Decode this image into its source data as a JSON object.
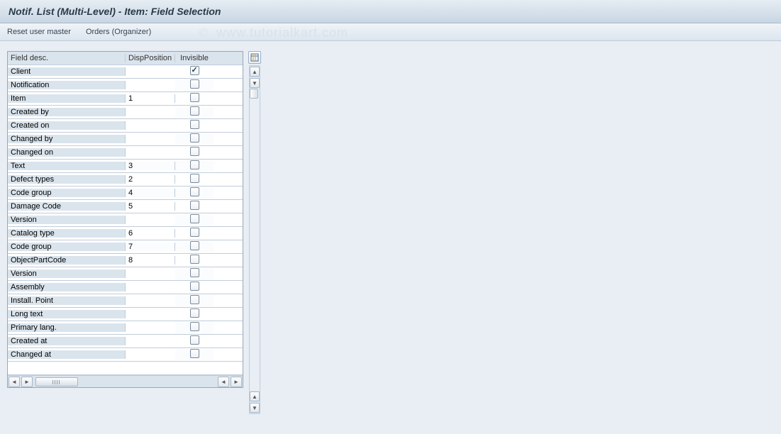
{
  "header": {
    "title": "Notif. List (Multi-Level) - Item: Field Selection"
  },
  "toolbar": {
    "reset_label": "Reset user master",
    "orders_label": "Orders (Organizer)"
  },
  "watermark": {
    "copy": "©",
    "text": "www.tutorialkart.com"
  },
  "grid": {
    "columns": {
      "desc": "Field desc.",
      "pos": "DispPosition",
      "inv": "Invisible"
    },
    "rows": [
      {
        "desc": "Client",
        "pos": "",
        "inv": true
      },
      {
        "desc": "Notification",
        "pos": "",
        "inv": false
      },
      {
        "desc": "Item",
        "pos": "1",
        "inv": false
      },
      {
        "desc": "Created by",
        "pos": "",
        "inv": false
      },
      {
        "desc": "Created on",
        "pos": "",
        "inv": false
      },
      {
        "desc": "Changed by",
        "pos": "",
        "inv": false
      },
      {
        "desc": "Changed on",
        "pos": "",
        "inv": false
      },
      {
        "desc": "Text",
        "pos": "3",
        "inv": false
      },
      {
        "desc": "Defect types",
        "pos": "2",
        "inv": false
      },
      {
        "desc": "Code group",
        "pos": "4",
        "inv": false
      },
      {
        "desc": "Damage Code",
        "pos": "5",
        "inv": false
      },
      {
        "desc": "Version",
        "pos": "",
        "inv": false
      },
      {
        "desc": "Catalog type",
        "pos": "6",
        "inv": false
      },
      {
        "desc": "Code group",
        "pos": "7",
        "inv": false
      },
      {
        "desc": "ObjectPartCode",
        "pos": "8",
        "inv": false
      },
      {
        "desc": "Version",
        "pos": "",
        "inv": false
      },
      {
        "desc": "Assembly",
        "pos": "",
        "inv": false
      },
      {
        "desc": "Install. Point",
        "pos": "",
        "inv": false
      },
      {
        "desc": "Long text",
        "pos": "",
        "inv": false
      },
      {
        "desc": "Primary lang.",
        "pos": "",
        "inv": false
      },
      {
        "desc": "Created at",
        "pos": "",
        "inv": false
      },
      {
        "desc": "Changed at",
        "pos": "",
        "inv": false
      }
    ]
  }
}
